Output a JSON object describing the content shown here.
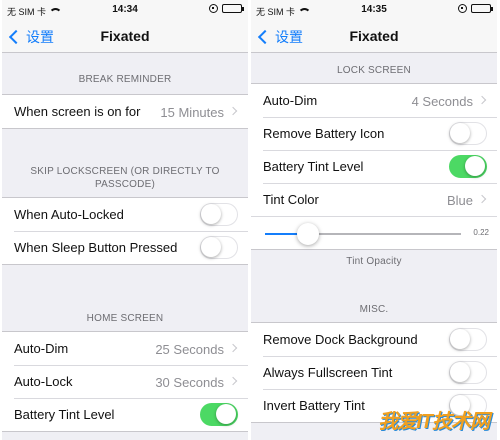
{
  "left_screen": {
    "status": {
      "carrier": "无 SIM 卡",
      "time": "14:34"
    },
    "nav": {
      "back_label": "设置",
      "title": "Fixated"
    },
    "sections": [
      {
        "header": "BREAK REMINDER",
        "rows": [
          {
            "label": "When screen is on for",
            "type": "value",
            "value": "15 Minutes"
          }
        ]
      },
      {
        "header": "SKIP LOCKSCREEN (OR DIRECTLY TO PASSCODE)",
        "rows": [
          {
            "label": "When Auto-Locked",
            "type": "switch",
            "on": false
          },
          {
            "label": "When Sleep Button Pressed",
            "type": "switch",
            "on": false
          }
        ]
      },
      {
        "header": "HOME SCREEN",
        "rows": [
          {
            "label": "Auto-Dim",
            "type": "value",
            "value": "25 Seconds"
          },
          {
            "label": "Auto-Lock",
            "type": "value",
            "value": "30 Seconds"
          },
          {
            "label": "Battery Tint Level",
            "type": "switch",
            "on": true
          }
        ]
      }
    ]
  },
  "right_screen": {
    "status": {
      "carrier": "无 SIM 卡",
      "time": "14:35"
    },
    "nav": {
      "back_label": "设置",
      "title": "Fixated"
    },
    "lock_screen": {
      "header": "LOCK SCREEN",
      "rows": [
        {
          "label": "Auto-Dim",
          "type": "value",
          "value": "4 Seconds"
        },
        {
          "label": "Remove Battery Icon",
          "type": "switch",
          "on": false
        },
        {
          "label": "Battery Tint Level",
          "type": "switch",
          "on": true
        },
        {
          "label": "Tint Color",
          "type": "value",
          "value": "Blue"
        }
      ],
      "slider": {
        "value": 0.22,
        "value_label": "0.22",
        "footer": "Tint Opacity"
      }
    },
    "misc": {
      "header": "MISC.",
      "rows": [
        {
          "label": "Remove Dock Background",
          "type": "switch",
          "on": false
        },
        {
          "label": "Always Fullscreen Tint",
          "type": "switch",
          "on": false
        },
        {
          "label": "Invert Battery Tint",
          "type": "switch",
          "on": false
        }
      ]
    }
  },
  "watermark": "我爱IT技术网",
  "colors": {
    "accent": "#147efb",
    "switch_on": "#4cd964",
    "background": "#efeff4"
  }
}
